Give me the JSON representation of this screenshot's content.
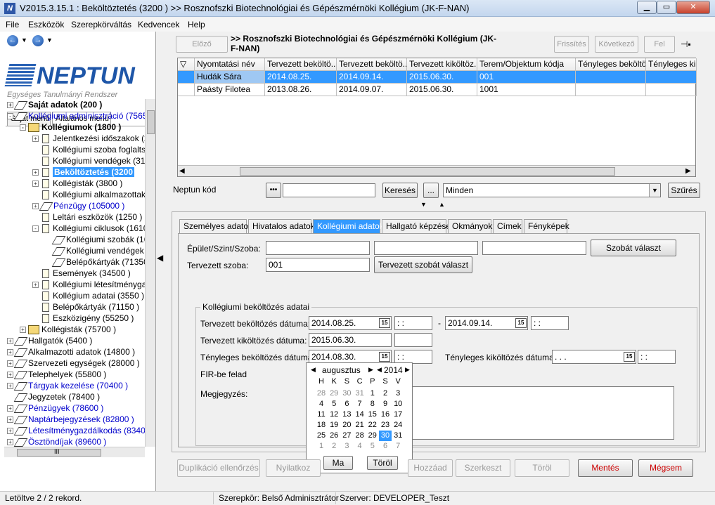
{
  "window": {
    "title": "V2015.3.15.1 : Beköltöztetés (3200 ) >> Rosznofszki Biotechnológiai és Gépészmérnöki Kollégium (JK-F-NAN)"
  },
  "menu": [
    "File",
    "Eszközök",
    "Szerepkörváltás",
    "Kedvencek",
    "Help"
  ],
  "logo": {
    "name": "NEPTUN",
    "tagline": "Egységes Tanulmányi Rendszer"
  },
  "left_tabs": [
    "Saját menü",
    "Általános menü"
  ],
  "tree": [
    {
      "label": "Saját adatok (200 )",
      "level": 0,
      "exp": "+",
      "icon": "book",
      "style": "bold"
    },
    {
      "label": "Kollégiumi adminisztráció (75650",
      "level": 0,
      "exp": "-",
      "icon": "book",
      "style": "blue"
    },
    {
      "label": "Kollégiumok (1800 )",
      "level": 1,
      "exp": "-",
      "icon": "fold",
      "style": "bold"
    },
    {
      "label": "Jelentkezési időszakok (2",
      "level": 2,
      "exp": "+",
      "icon": "doc",
      "style": ""
    },
    {
      "label": "Kollégiumi szoba foglaltsá",
      "level": 2,
      "exp": "",
      "icon": "doc",
      "style": ""
    },
    {
      "label": "Kollégiumi vendégek (315",
      "level": 2,
      "exp": "",
      "icon": "doc",
      "style": ""
    },
    {
      "label": "Beköltöztetés (3200",
      "level": 2,
      "exp": "+",
      "icon": "doc",
      "style": "sel"
    },
    {
      "label": "Kollégisták (3800 )",
      "level": 2,
      "exp": "+",
      "icon": "doc",
      "style": ""
    },
    {
      "label": "Kollégiumi alkalmazottak (",
      "level": 2,
      "exp": "",
      "icon": "doc",
      "style": ""
    },
    {
      "label": "Pénzügy (105000 )",
      "level": 2,
      "exp": "+",
      "icon": "book",
      "style": "blue"
    },
    {
      "label": "Leltári eszközök (1250 )",
      "level": 2,
      "exp": "",
      "icon": "doc",
      "style": ""
    },
    {
      "label": "Kollégiumi ciklusok (1610",
      "level": 2,
      "exp": "-",
      "icon": "doc",
      "style": ""
    },
    {
      "label": "Kollégiumi szobák (16",
      "level": 3,
      "exp": "",
      "icon": "book",
      "style": ""
    },
    {
      "label": "Kollégiumi vendégek",
      "level": 3,
      "exp": "",
      "icon": "book",
      "style": ""
    },
    {
      "label": "Belépőkártyák (71350",
      "level": 3,
      "exp": "",
      "icon": "book",
      "style": ""
    },
    {
      "label": "Események (34500 )",
      "level": 2,
      "exp": "",
      "icon": "doc",
      "style": ""
    },
    {
      "label": "Kollégiumi létesítménygaz",
      "level": 2,
      "exp": "+",
      "icon": "doc",
      "style": ""
    },
    {
      "label": "Kollégium adatai (3550 )",
      "level": 2,
      "exp": "",
      "icon": "doc",
      "style": ""
    },
    {
      "label": "Belépőkártyák (71150 )",
      "level": 2,
      "exp": "",
      "icon": "doc",
      "style": ""
    },
    {
      "label": "Eszközigény (55250 )",
      "level": 2,
      "exp": "",
      "icon": "doc",
      "style": ""
    },
    {
      "label": "Kollégisták (75700 )",
      "level": 1,
      "exp": "+",
      "icon": "fold",
      "style": ""
    },
    {
      "label": "Hallgatók (5400 )",
      "level": 0,
      "exp": "+",
      "icon": "book",
      "style": ""
    },
    {
      "label": "Alkalmazotti adatok (14800 )",
      "level": 0,
      "exp": "+",
      "icon": "book",
      "style": ""
    },
    {
      "label": "Szervezeti egységek (28000 )",
      "level": 0,
      "exp": "+",
      "icon": "book",
      "style": ""
    },
    {
      "label": "Telephelyek (55800 )",
      "level": 0,
      "exp": "+",
      "icon": "book",
      "style": ""
    },
    {
      "label": "Tárgyak kezelése (70400 )",
      "level": 0,
      "exp": "+",
      "icon": "book",
      "style": "blue"
    },
    {
      "label": "Jegyzetek (78400 )",
      "level": 0,
      "exp": "",
      "icon": "book",
      "style": ""
    },
    {
      "label": "Pénzügyek (78600 )",
      "level": 0,
      "exp": "+",
      "icon": "book",
      "style": "blue"
    },
    {
      "label": "Naptárbejegyzések (82800 )",
      "level": 0,
      "exp": "+",
      "icon": "book",
      "style": "blue"
    },
    {
      "label": "Létesítménygazdálkodás (83400",
      "level": 0,
      "exp": "+",
      "icon": "book",
      "style": "blue"
    },
    {
      "label": "Ösztöndíjak (89600 )",
      "level": 0,
      "exp": "+",
      "icon": "book",
      "style": "blue"
    }
  ],
  "tree_scroll_label": "III",
  "toolbar": {
    "prev": "Előző",
    "breadcrumb": ">> Rosznofszki Biotechnológiai és Gépészmérnöki Kollégium (JK-F-NAN)",
    "refresh": "Frissítés",
    "next": "Következő",
    "up": "Fel",
    "pin": "⊣▪"
  },
  "grid": {
    "columns": [
      "Nyomtatási név",
      "Tervezett beköltö...",
      "Tervezett beköltö...",
      "Tervezett kiköltöz...",
      "Terem/Objektum kódja",
      "Tényleges beköltö...",
      "Tényleges kikö"
    ],
    "rows": [
      [
        "Hudák Sára",
        "2014.08.25.",
        "2014.09.14.",
        "2015.06.30.",
        "001",
        "",
        ""
      ],
      [
        "Paásty Filotea",
        "2013.08.26.",
        "2014.09.07.",
        "2015.06.30.",
        "1001",
        "",
        ""
      ]
    ]
  },
  "search": {
    "label": "Neptun kód",
    "value": "",
    "search_btn": "Keresés",
    "more_btn": "...",
    "combo": "Minden",
    "filter_btn": "Szűrés",
    "dots": "•••"
  },
  "detail_tabs": [
    "Személyes adatok",
    "Hivatalos adatok",
    "Kollégiumi adatok",
    "Hallgató képzései",
    "Okmányok",
    "Címek",
    "Fényképek"
  ],
  "form": {
    "building_label": "Épület/Szint/Szoba:",
    "room_select_btn": "Szobát választ",
    "planned_room_label": "Tervezett szoba:",
    "planned_room_value": "001",
    "planned_room_btn": "Tervezett szobát választ",
    "group_title": "Kollégiumi beköltözés adatai",
    "planned_in_label": "Tervezett beköltözés dátuma:",
    "planned_in_from": "2014.08.25.",
    "planned_in_to": "2014.09.14.",
    "range_dash": "-",
    "planned_out_label": "Tervezett kiköltözés dátuma:",
    "planned_out_value": "2015.06.30.",
    "actual_in_label": "Tényleges beköltözés dátuma:",
    "actual_in_value": "2014.08.30.",
    "actual_out_label": "Tényleges kiköltözés dátuma:",
    "actual_out_value": " .  .  .",
    "time_placeholder": " :  :",
    "fir_label": "FIR-be felad",
    "note_label": "Megjegyzés:",
    "cal_icon_text": "15"
  },
  "calendar": {
    "month": "augusztus",
    "year": "2014",
    "weekdays": [
      "H",
      "K",
      "S",
      "C",
      "P",
      "S",
      "V"
    ],
    "weeks": [
      [
        "28",
        "29",
        "30",
        "31",
        "1",
        "2",
        "3"
      ],
      [
        "4",
        "5",
        "6",
        "7",
        "8",
        "9",
        "10"
      ],
      [
        "11",
        "12",
        "13",
        "14",
        "15",
        "16",
        "17"
      ],
      [
        "18",
        "19",
        "20",
        "21",
        "22",
        "23",
        "24"
      ],
      [
        "25",
        "26",
        "27",
        "28",
        "29",
        "30",
        "31"
      ],
      [
        "1",
        "2",
        "3",
        "4",
        "5",
        "6",
        "7"
      ]
    ],
    "selected": "30",
    "today_btn": "Ma",
    "clear_btn": "Töröl"
  },
  "bottom_buttons": [
    "Duplikáció ellenőrzés",
    "Nyilatkoz",
    "Hozzáad",
    "Szerkeszt",
    "Töröl",
    "Mentés",
    "Mégsem"
  ],
  "status": {
    "records": "Letöltve 2 / 2 rekord.",
    "role": "Szerepkör: Belső Adminisztrátor",
    "server": "Szerver: DEVELOPER_Teszt"
  },
  "colors": {
    "selection": "#3399ff",
    "brand": "#1e56a8",
    "danger": "#cc0000"
  }
}
